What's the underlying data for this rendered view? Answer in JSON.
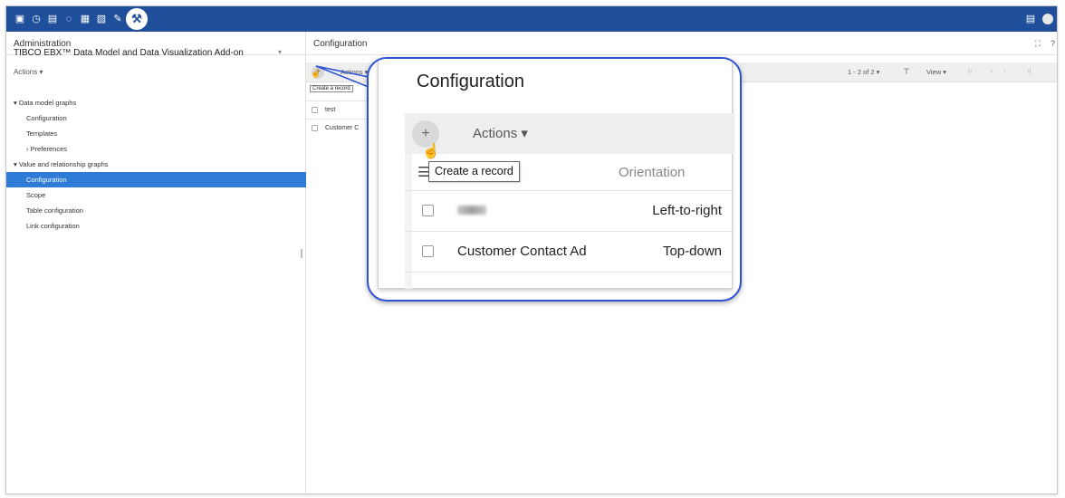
{
  "topbar": {
    "icons": [
      "database-icon",
      "clock-icon",
      "document-check-icon",
      "bulb-icon",
      "stack-icon",
      "edit-document-icon",
      "pin-icon",
      "wrench-icon"
    ],
    "right_icons": [
      "grid-icon",
      "user-avatar-icon"
    ],
    "bg_color": "#1f4e9a"
  },
  "left": {
    "header": "Administration",
    "model_title": "TIBCO EBX™ Data Model and Data Visualization Add-on",
    "actions": "Actions ▾",
    "tree": [
      {
        "label": "▾ Data model graphs",
        "level": 0,
        "selected": false
      },
      {
        "label": "Configuration",
        "level": 1,
        "selected": false
      },
      {
        "label": "Templates",
        "level": 1,
        "selected": false
      },
      {
        "label": "› Preferences",
        "level": 1,
        "selected": false
      },
      {
        "label": "▾ Value and relationship graphs",
        "level": 0,
        "selected": false
      },
      {
        "label": "Configuration",
        "level": 1,
        "selected": true
      },
      {
        "label": "Scope",
        "level": 1,
        "selected": false
      },
      {
        "label": "Table configuration",
        "level": 1,
        "selected": false
      },
      {
        "label": "Link configuration",
        "level": 1,
        "selected": false
      }
    ]
  },
  "right": {
    "header": "Configuration",
    "toolbar": {
      "add": "+",
      "actions": "Actions ▾",
      "pager": "1 - 2 of 2 ▾",
      "view": "View ▾",
      "nav_first": "|‹",
      "nav_prev": "‹",
      "nav_next": "›",
      "nav_last": "›|"
    },
    "tooltip": "Create a record",
    "rows": [
      "test",
      "Customer C"
    ],
    "header_icons": {
      "fullscreen": "⛶",
      "help": "?"
    }
  },
  "callout": {
    "title": "Configuration",
    "add": "+",
    "actions": "Actions ▾",
    "tooltip": "Create a record",
    "orientation_header": "Orientation",
    "rows": [
      {
        "name": "",
        "orientation": "Left-to-right",
        "blurred": true
      },
      {
        "name": "Customer Contact Ad",
        "orientation": "Top-down",
        "blurred": false
      }
    ],
    "border_color": "#2e52d6"
  }
}
